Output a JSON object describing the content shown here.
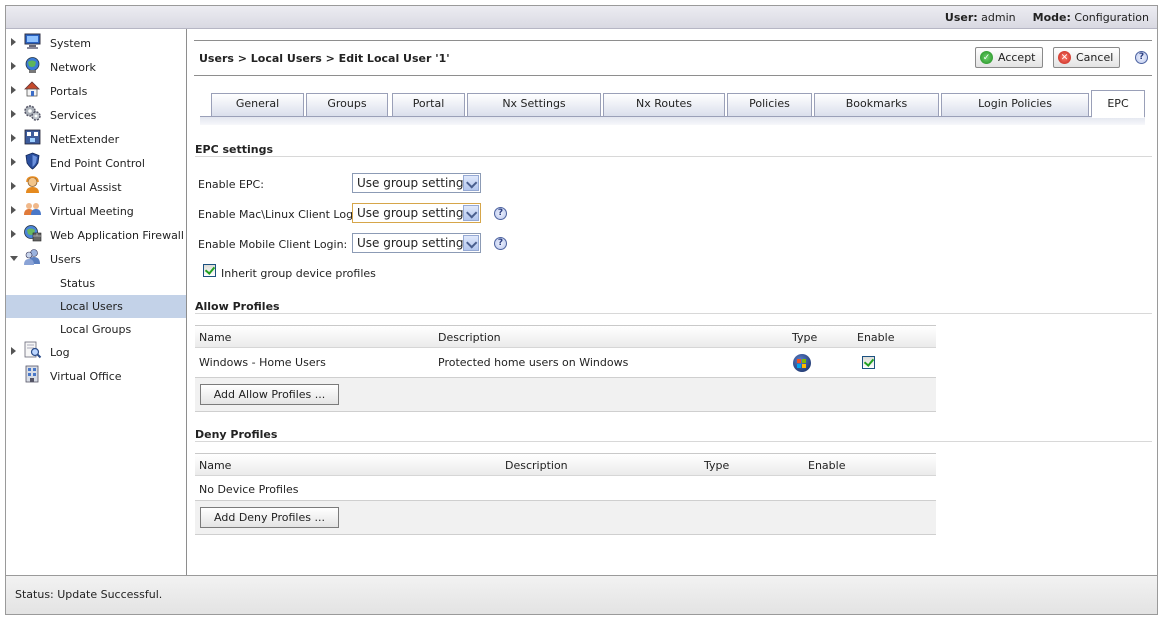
{
  "header": {
    "user_label": "User:",
    "user_value": "admin",
    "mode_label": "Mode:",
    "mode_value": "Configuration"
  },
  "sidebar": {
    "items": [
      {
        "label": "System",
        "icon": "monitor-icon"
      },
      {
        "label": "Network",
        "icon": "network-globe-icon"
      },
      {
        "label": "Portals",
        "icon": "portal-house-icon"
      },
      {
        "label": "Services",
        "icon": "gears-icon"
      },
      {
        "label": "NetExtender",
        "icon": "netextender-icon"
      },
      {
        "label": "End Point Control",
        "icon": "shield-icon"
      },
      {
        "label": "Virtual Assist",
        "icon": "assist-person-icon"
      },
      {
        "label": "Virtual Meeting",
        "icon": "meeting-people-icon"
      },
      {
        "label": "Web Application Firewall",
        "icon": "firewall-globe-icon"
      },
      {
        "label": "Users",
        "icon": "users-icon"
      },
      {
        "label": "Log",
        "icon": "log-magnifier-icon"
      },
      {
        "label": "Virtual Office",
        "icon": "virtual-office-icon"
      }
    ],
    "users_subitems": [
      "Status",
      "Local Users",
      "Local Groups"
    ]
  },
  "main": {
    "breadcrumb": "Users > Local Users > Edit Local User '1'",
    "accept_label": "Accept",
    "cancel_label": "Cancel",
    "tabs": [
      "General",
      "Groups",
      "Portal",
      "Nx Settings",
      "Nx Routes",
      "Policies",
      "Bookmarks",
      "Login Policies",
      "EPC"
    ],
    "active_tab": "EPC"
  },
  "epc": {
    "section_title": "EPC settings",
    "enable_epc_label": "Enable EPC:",
    "enable_epc_value": "Use group setting",
    "mac_linux_label": "Enable Mac\\Linux Client Login:",
    "mac_linux_value": "Use group setting",
    "mobile_label": "Enable Mobile Client Login:",
    "mobile_value": "Use group setting",
    "inherit_label": "Inherit group device profiles",
    "inherit_checked": true
  },
  "allow_profiles": {
    "title": "Allow Profiles",
    "columns": [
      "Name",
      "Description",
      "Type",
      "Enable"
    ],
    "rows": [
      {
        "name": "Windows - Home Users",
        "description": "Protected home users on Windows",
        "type_icon": "windows-logo-icon",
        "enabled": true
      }
    ],
    "add_button": "Add Allow Profiles ..."
  },
  "deny_profiles": {
    "title": "Deny Profiles",
    "columns": [
      "Name",
      "Description",
      "Type",
      "Enable"
    ],
    "empty_text": "No Device Profiles",
    "add_button": "Add Deny Profiles ..."
  },
  "status": {
    "text": "Status: Update Successful."
  }
}
